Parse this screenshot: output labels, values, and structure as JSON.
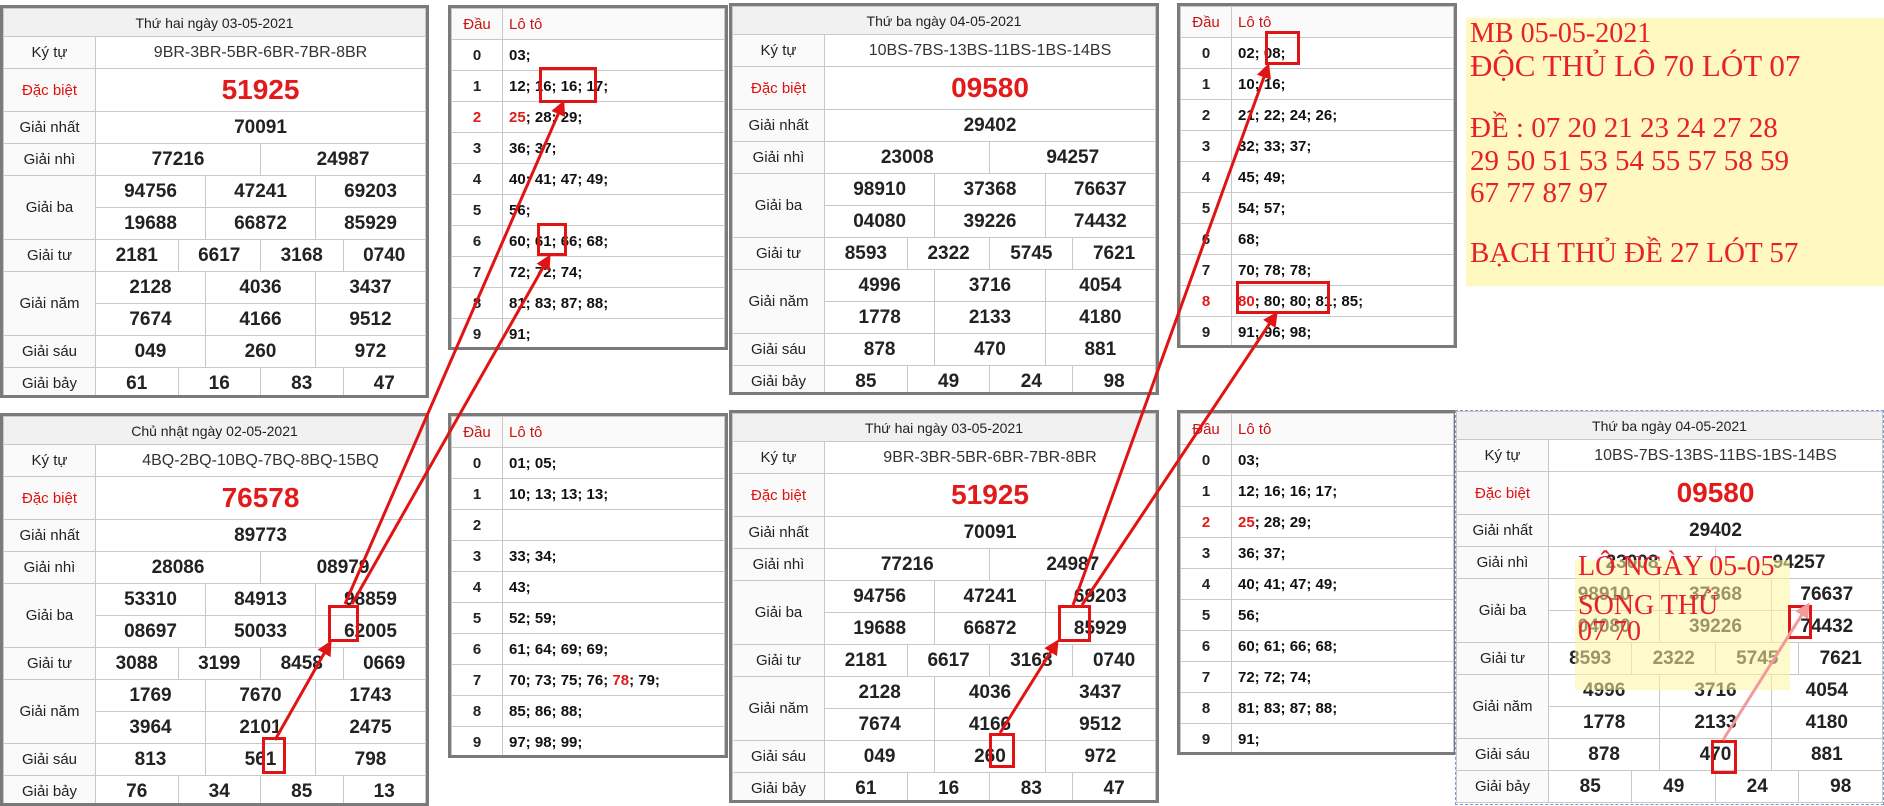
{
  "labels": {
    "ky_tu": "Ký tự",
    "dac_biet": "Đặc biệt",
    "giai_nhat": "Giải nhất",
    "giai_nhi": "Giải nhì",
    "giai_ba": "Giải ba",
    "giai_tu": "Giải tư",
    "giai_nam": "Giải năm",
    "giai_sau": "Giải sáu",
    "giai_bay": "Giải bảy",
    "dau": "Đầu",
    "loto": "Lô tô"
  },
  "results": [
    {
      "date": "Thứ hai ngày 03-05-2021",
      "ky_tu": "9BR-3BR-5BR-6BR-7BR-8BR",
      "dac_biet": "51925",
      "g1": "70091",
      "g2": [
        "77216",
        "24987"
      ],
      "g3": [
        "94756",
        "47241",
        "69203",
        "19688",
        "66872",
        "85929"
      ],
      "g4": [
        "2181",
        "6617",
        "3168",
        "0740"
      ],
      "g5": [
        "2128",
        "4036",
        "3437",
        "7674",
        "4166",
        "9512"
      ],
      "g6": [
        "049",
        "260",
        "972"
      ],
      "g7": [
        "61",
        "16",
        "83",
        "47"
      ]
    },
    {
      "date": "Thứ ba ngày 04-05-2021",
      "ky_tu": "10BS-7BS-13BS-11BS-1BS-14BS",
      "dac_biet": "09580",
      "g1": "29402",
      "g2": [
        "23008",
        "94257"
      ],
      "g3": [
        "98910",
        "37368",
        "76637",
        "04080",
        "39226",
        "74432"
      ],
      "g4": [
        "8593",
        "2322",
        "5745",
        "7621"
      ],
      "g5": [
        "4996",
        "3716",
        "4054",
        "1778",
        "2133",
        "4180"
      ],
      "g6": [
        "878",
        "470",
        "881"
      ],
      "g7": [
        "85",
        "49",
        "24",
        "98"
      ]
    },
    {
      "date": "Chủ nhật ngày 02-05-2021",
      "ky_tu": "4BQ-2BQ-10BQ-7BQ-8BQ-15BQ",
      "dac_biet": "76578",
      "g1": "89773",
      "g2": [
        "28086",
        "08979"
      ],
      "g3": [
        "53310",
        "84913",
        "98859",
        "08697",
        "50033",
        "62005"
      ],
      "g4": [
        "3088",
        "3199",
        "8458",
        "0669"
      ],
      "g5": [
        "1769",
        "7670",
        "1743",
        "3964",
        "2101",
        "2475"
      ],
      "g6": [
        "813",
        "561",
        "798"
      ],
      "g7": [
        "76",
        "34",
        "85",
        "13"
      ]
    }
  ],
  "lotos": [
    {
      "rows": [
        {
          "d": "0",
          "n": [
            {
              "t": "03;"
            }
          ]
        },
        {
          "d": "1",
          "n": [
            {
              "t": "12; 16; 16; 17;"
            }
          ]
        },
        {
          "d": "2",
          "red": true,
          "n": [
            {
              "t": "25",
              "red": true
            },
            {
              "t": "; 28; 29;"
            }
          ]
        },
        {
          "d": "3",
          "n": [
            {
              "t": "36; 37;"
            }
          ]
        },
        {
          "d": "4",
          "n": [
            {
              "t": "40; 41; 47; 49;"
            }
          ]
        },
        {
          "d": "5",
          "n": [
            {
              "t": "56;"
            }
          ]
        },
        {
          "d": "6",
          "n": [
            {
              "t": "60; 61; 66; 68;"
            }
          ]
        },
        {
          "d": "7",
          "n": [
            {
              "t": "72; 72; 74;"
            }
          ]
        },
        {
          "d": "8",
          "n": [
            {
              "t": "81; 83; 87; 88;"
            }
          ]
        },
        {
          "d": "9",
          "n": [
            {
              "t": "91;"
            }
          ]
        }
      ]
    },
    {
      "rows": [
        {
          "d": "0",
          "n": [
            {
              "t": "02; 08;"
            }
          ]
        },
        {
          "d": "1",
          "n": [
            {
              "t": "10; 16;"
            }
          ]
        },
        {
          "d": "2",
          "n": [
            {
              "t": "21; 22; 24; 26;"
            }
          ]
        },
        {
          "d": "3",
          "n": [
            {
              "t": "32; 33; 37;"
            }
          ]
        },
        {
          "d": "4",
          "n": [
            {
              "t": "45; 49;"
            }
          ]
        },
        {
          "d": "5",
          "n": [
            {
              "t": "54; 57;"
            }
          ]
        },
        {
          "d": "6",
          "n": [
            {
              "t": "68;"
            }
          ]
        },
        {
          "d": "7",
          "n": [
            {
              "t": "70; 78; 78;"
            }
          ]
        },
        {
          "d": "8",
          "red": true,
          "n": [
            {
              "t": "80",
              "red": true
            },
            {
              "t": "; 80; 80; 81; 85;"
            }
          ]
        },
        {
          "d": "9",
          "n": [
            {
              "t": "91; 96; 98;"
            }
          ]
        }
      ]
    },
    {
      "rows": [
        {
          "d": "0",
          "n": [
            {
              "t": "01; 05;"
            }
          ]
        },
        {
          "d": "1",
          "n": [
            {
              "t": "10; 13; 13; 13;"
            }
          ]
        },
        {
          "d": "2",
          "n": [
            {
              "t": ""
            }
          ]
        },
        {
          "d": "3",
          "n": [
            {
              "t": "33; 34;"
            }
          ]
        },
        {
          "d": "4",
          "n": [
            {
              "t": "43;"
            }
          ]
        },
        {
          "d": "5",
          "n": [
            {
              "t": "52; 59;"
            }
          ]
        },
        {
          "d": "6",
          "n": [
            {
              "t": "61; 64; 69; 69;"
            }
          ]
        },
        {
          "d": "7",
          "n": [
            {
              "t": "70; 73; 75; 76; "
            },
            {
              "t": "78",
              "red": true
            },
            {
              "t": "; 79;"
            }
          ]
        },
        {
          "d": "8",
          "n": [
            {
              "t": "85; 86; 88;"
            }
          ]
        },
        {
          "d": "9",
          "n": [
            {
              "t": "97; 98; 99;"
            }
          ]
        }
      ]
    }
  ],
  "notes": {
    "line1": "MB 05-05-2021",
    "line2": "ĐỘC THỦ LÔ 70 LÓT 07",
    "line3": "ĐỀ : 07 20 21 23 24 27 28",
    "line4": "29 50 51 53 54 55 57 58 59",
    "line5": "67 77 87 97",
    "line6": "BẠCH THỦ ĐỀ 27 LÓT 57"
  },
  "overlay": {
    "line1": "LÔ NGÀY 05-05",
    "line2": "SONG THỦ",
    "line3": "07 70"
  },
  "colors": {
    "accent_red": "#e21a1a",
    "border": "#7a7a7a"
  }
}
